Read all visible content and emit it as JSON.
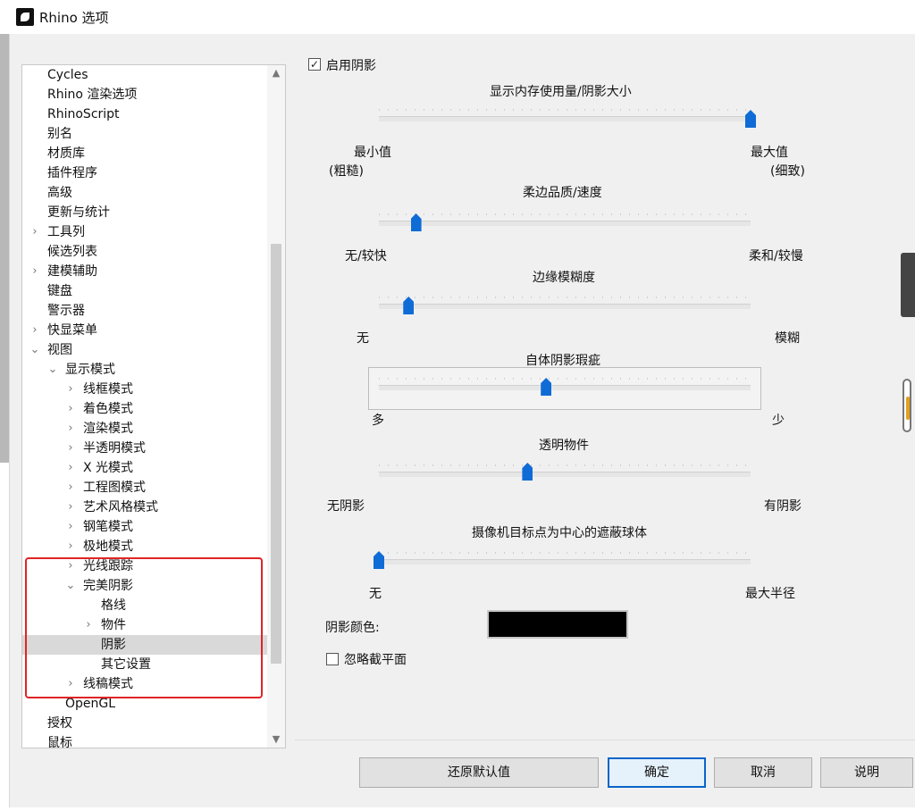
{
  "window": {
    "title": "Rhino 选项"
  },
  "tree": {
    "items": [
      {
        "label": "Cycles",
        "indent": 0,
        "expand": ""
      },
      {
        "label": "Rhino 渲染选项",
        "indent": 0,
        "expand": ""
      },
      {
        "label": "RhinoScript",
        "indent": 0,
        "expand": ""
      },
      {
        "label": "别名",
        "indent": 0,
        "expand": ""
      },
      {
        "label": "材质库",
        "indent": 0,
        "expand": ""
      },
      {
        "label": "插件程序",
        "indent": 0,
        "expand": ""
      },
      {
        "label": "高级",
        "indent": 0,
        "expand": ""
      },
      {
        "label": "更新与统计",
        "indent": 0,
        "expand": ""
      },
      {
        "label": "工具列",
        "indent": 0,
        "expand": "collapsed"
      },
      {
        "label": "候选列表",
        "indent": 0,
        "expand": ""
      },
      {
        "label": "建模辅助",
        "indent": 0,
        "expand": "collapsed"
      },
      {
        "label": "键盘",
        "indent": 0,
        "expand": ""
      },
      {
        "label": "警示器",
        "indent": 0,
        "expand": ""
      },
      {
        "label": "快显菜单",
        "indent": 0,
        "expand": "collapsed"
      },
      {
        "label": "视图",
        "indent": 0,
        "expand": "expanded"
      },
      {
        "label": "显示模式",
        "indent": 1,
        "expand": "expanded"
      },
      {
        "label": "线框模式",
        "indent": 2,
        "expand": "collapsed"
      },
      {
        "label": "着色模式",
        "indent": 2,
        "expand": "collapsed"
      },
      {
        "label": "渲染模式",
        "indent": 2,
        "expand": "collapsed"
      },
      {
        "label": "半透明模式",
        "indent": 2,
        "expand": "collapsed"
      },
      {
        "label": "X 光模式",
        "indent": 2,
        "expand": "collapsed"
      },
      {
        "label": "工程图模式",
        "indent": 2,
        "expand": "collapsed"
      },
      {
        "label": "艺术风格模式",
        "indent": 2,
        "expand": "collapsed"
      },
      {
        "label": "钢笔模式",
        "indent": 2,
        "expand": "collapsed"
      },
      {
        "label": "极地模式",
        "indent": 2,
        "expand": "collapsed"
      },
      {
        "label": "光线跟踪",
        "indent": 2,
        "expand": "collapsed"
      },
      {
        "label": "完美阴影",
        "indent": 2,
        "expand": "expanded"
      },
      {
        "label": "格线",
        "indent": 3,
        "expand": ""
      },
      {
        "label": "物件",
        "indent": 3,
        "expand": "collapsed"
      },
      {
        "label": "阴影",
        "indent": 3,
        "expand": "",
        "selected": true
      },
      {
        "label": "其它设置",
        "indent": 3,
        "expand": ""
      },
      {
        "label": "线稿模式",
        "indent": 2,
        "expand": "collapsed"
      },
      {
        "label": "OpenGL",
        "indent": 1,
        "expand": ""
      },
      {
        "label": "授权",
        "indent": 0,
        "expand": ""
      },
      {
        "label": "鼠标",
        "indent": 0,
        "expand": ""
      }
    ]
  },
  "settings": {
    "enable_shadows": {
      "label": "启用阴影",
      "checked": true
    },
    "memory_slider": {
      "title": "显示内存使用量/阴影大小",
      "min_label": "最小值",
      "min_sub": "(粗糙)",
      "max_label": "最大值",
      "max_sub": "(细致)",
      "value": 1.0
    },
    "softness_slider": {
      "title": "柔边品质/速度",
      "min_label": "无/较快",
      "max_label": "柔和/较慢",
      "value": 0.1
    },
    "blur_slider": {
      "title": "边缘模糊度",
      "min_label": "无",
      "max_label": "模糊",
      "value": 0.08
    },
    "self_shadow_slider": {
      "title": "自体阴影瑕疵",
      "min_label": "多",
      "max_label": "少",
      "value": 0.45
    },
    "transparent_slider": {
      "title": "透明物件",
      "min_label": "无阴影",
      "max_label": "有阴影",
      "value": 0.4
    },
    "camera_slider": {
      "title": "摄像机目标点为中心的遮蔽球体",
      "min_label": "无",
      "max_label": "最大半径",
      "value": 0.0
    },
    "shadow_color": {
      "label": "阴影颜色:",
      "value": "#000000"
    },
    "ignore_clipping": {
      "label": "忽略截平面",
      "checked": false
    }
  },
  "buttons": {
    "restore": "还原默认值",
    "ok": "确定",
    "cancel": "取消",
    "help": "说明"
  },
  "colors": {
    "accent": "#0f6cd6",
    "highlight": "#e02424"
  }
}
